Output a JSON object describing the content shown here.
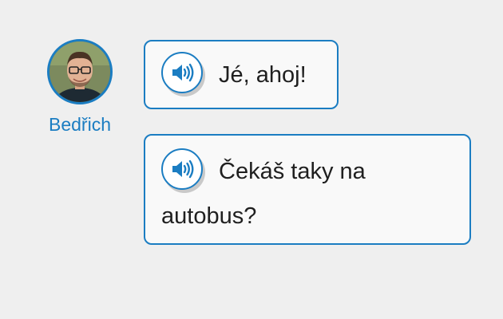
{
  "speaker": {
    "name": "Bedřich",
    "avatar_icon": "person-photo"
  },
  "messages": [
    {
      "text": "Jé, ahoj!",
      "icon": "speaker-icon"
    },
    {
      "text": "Čekáš taky na autobus?",
      "icon": "speaker-icon"
    }
  ],
  "colors": {
    "accent": "#1b7dc2",
    "background": "#efefef",
    "bubble_bg": "#f9f9f9",
    "text": "#1f1f1f"
  }
}
